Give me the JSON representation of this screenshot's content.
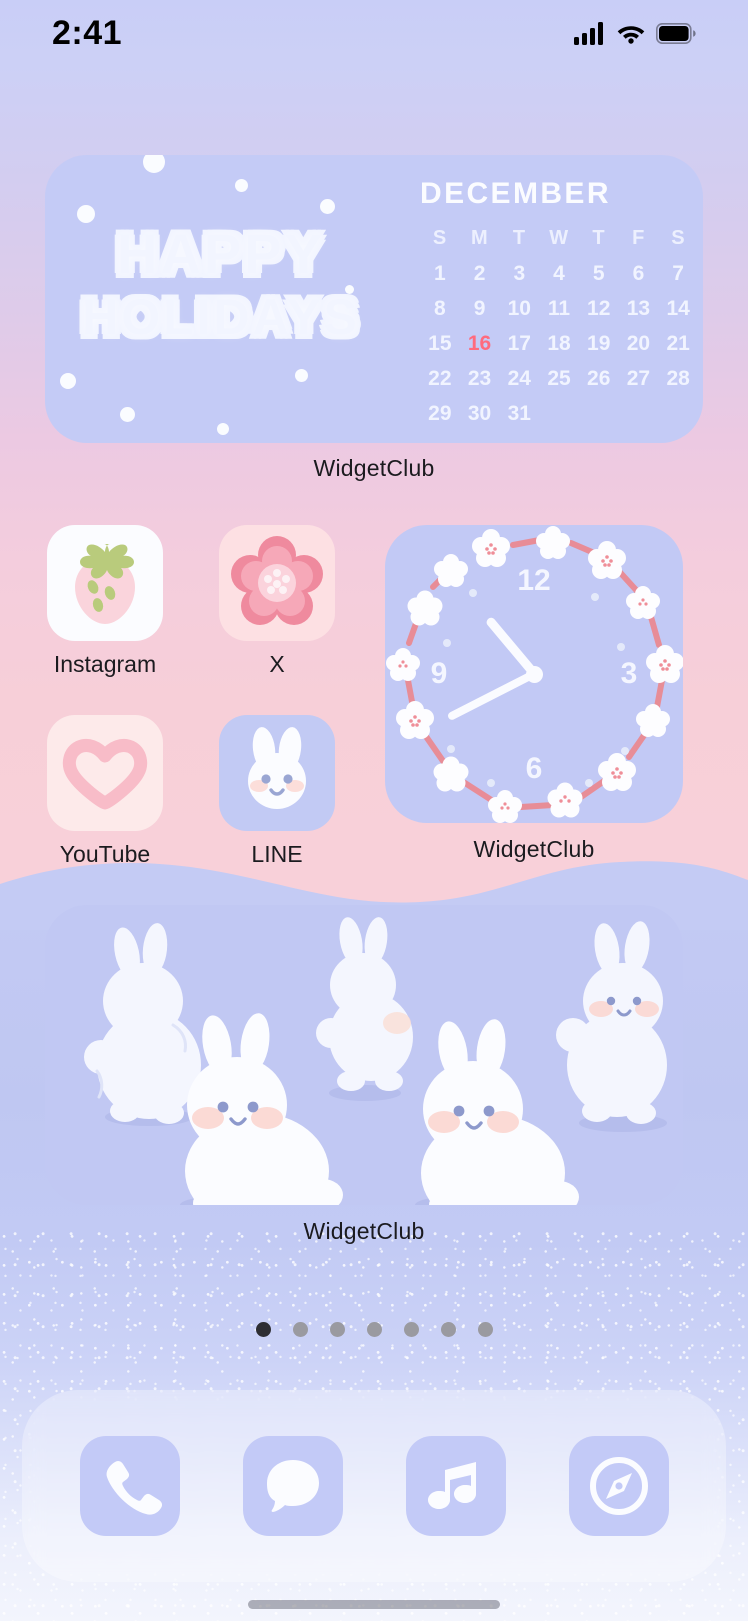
{
  "status_bar": {
    "time": "2:41",
    "cellular_icon": "signal-bars-icon",
    "wifi_icon": "wifi-icon",
    "battery_icon": "battery-full-icon"
  },
  "theme": {
    "bg_top": "#c9cef7",
    "bg_mid_pink": "#f8d0d9",
    "bg_lower_blue": "#c2c9f3",
    "widget_blue": "#c4cbf6",
    "accent_pink": "#ff6b7e",
    "label_color": "#1b1b1f",
    "dock_tint": "#c3caf7"
  },
  "widgets": {
    "calendar": {
      "label": "WidgetClub",
      "greeting_line1": "HAPPY",
      "greeting_line2": "HOLIDAYS",
      "month": "DECEMBER",
      "day_headers": [
        "S",
        "M",
        "T",
        "W",
        "T",
        "F",
        "S"
      ],
      "weeks": [
        [
          "1",
          "2",
          "3",
          "4",
          "5",
          "6",
          "7"
        ],
        [
          "8",
          "9",
          "10",
          "11",
          "12",
          "13",
          "14"
        ],
        [
          "15",
          "16",
          "17",
          "18",
          "19",
          "20",
          "21"
        ],
        [
          "22",
          "23",
          "24",
          "25",
          "26",
          "27",
          "28"
        ],
        [
          "29",
          "30",
          "31",
          "",
          "",
          "",
          ""
        ]
      ],
      "today": "16"
    },
    "clock": {
      "label": "WidgetClub",
      "numerals": [
        "12",
        "3",
        "6",
        "9"
      ],
      "hour_angle_deg": 320,
      "minute_angle_deg": 243,
      "decoration": "cherry-blossom-wreath"
    },
    "bunny": {
      "label": "WidgetClub",
      "decoration": "white-bunnies-illustration",
      "bunny_count": 5
    }
  },
  "apps": [
    {
      "name": "Instagram",
      "icon": "strawberry-icon",
      "bg": "#fbfcff",
      "label": "Instagram"
    },
    {
      "name": "X",
      "icon": "plum-blossom-icon",
      "bg": "#fde0e3",
      "label": "X"
    },
    {
      "name": "YouTube",
      "icon": "heart-outline-icon",
      "bg": "#fdeaea",
      "label": "YouTube"
    },
    {
      "name": "LINE",
      "icon": "bunny-face-icon",
      "bg": "#c2caf4",
      "label": "LINE"
    }
  ],
  "dock": {
    "items": [
      {
        "name": "Phone",
        "icon": "phone-icon"
      },
      {
        "name": "Messages",
        "icon": "message-bubble-icon"
      },
      {
        "name": "Music",
        "icon": "music-note-icon"
      },
      {
        "name": "Safari",
        "icon": "compass-icon"
      }
    ]
  },
  "page_indicator": {
    "total_pages": 7,
    "current_page": 1
  }
}
